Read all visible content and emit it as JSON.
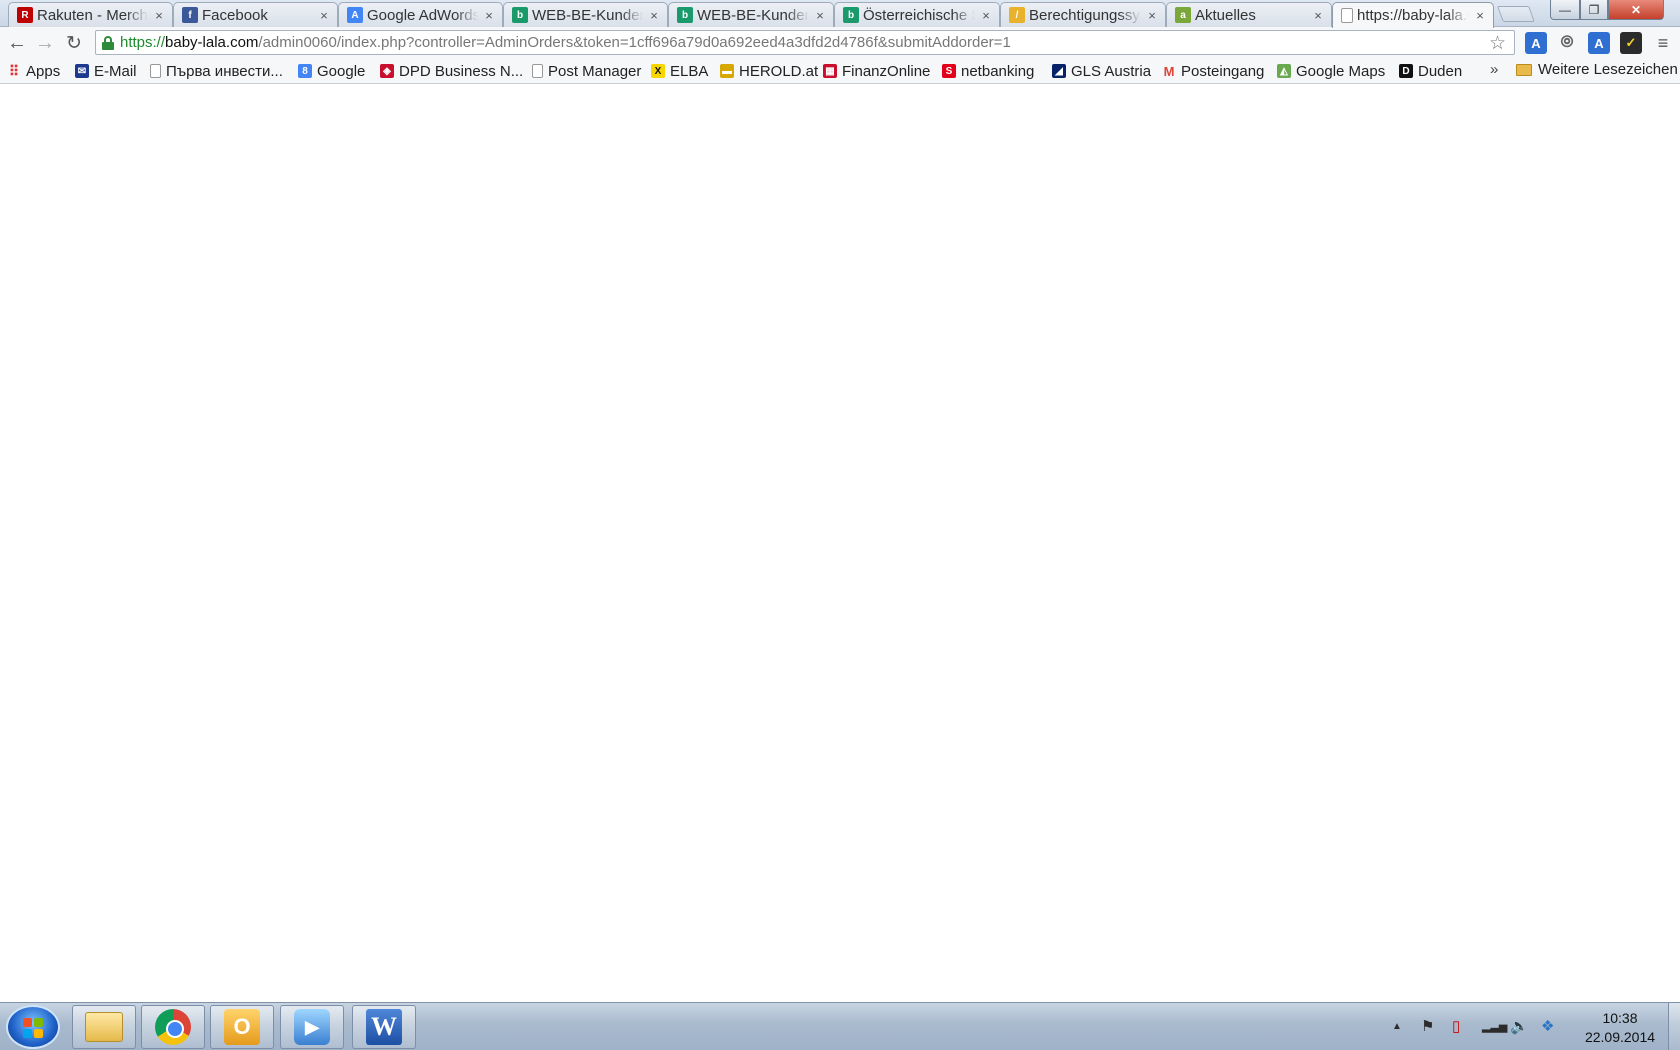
{
  "browser": {
    "tabs": [
      {
        "title": "Rakuten - Merchant",
        "favicon": "rakuten-icon",
        "icon_text": "R",
        "color": "#bf0000"
      },
      {
        "title": "Facebook",
        "favicon": "facebook-icon",
        "icon_text": "f",
        "color": "#3b5998"
      },
      {
        "title": "Google AdWords",
        "favicon": "adwords-icon",
        "icon_text": "A",
        "color": "#4285f4"
      },
      {
        "title": "WEB-BE-Kunden",
        "favicon": "web-be-icon",
        "icon_text": "b",
        "color": "#1a9a6b"
      },
      {
        "title": "WEB-BE-Kunden",
        "favicon": "web-be-icon",
        "icon_text": "b",
        "color": "#1a9a6b"
      },
      {
        "title": "Österreichische S",
        "favicon": "web-be-icon",
        "icon_text": "b",
        "color": "#1a9a6b"
      },
      {
        "title": "Berechtigungssystem",
        "favicon": "berechtigung-icon",
        "icon_text": "/",
        "color": "#e8b22d"
      },
      {
        "title": "Aktuelles",
        "favicon": "aktuelles-icon",
        "icon_text": "a",
        "color": "#7aa63a"
      },
      {
        "title": "https://baby-lala.com",
        "favicon": "page-icon",
        "icon_text": "",
        "color": "#ffffff",
        "active": true
      }
    ],
    "tab_close_glyph": "×",
    "window_buttons": {
      "minimize": "—",
      "maximize": "❐",
      "close": "✕"
    },
    "url": {
      "scheme": "https://",
      "host": "baby-lala.com",
      "path": "/admin0060/index.php?controller=AdminOrders&token=1cff696a79d0a692eed4a3dfd2d4786f&submitAddorder=1"
    },
    "nav": {
      "back": "←",
      "forward": "→",
      "reload": "↻",
      "star": "☆",
      "menu": "≡"
    },
    "extensions": {
      "translate": "A",
      "opera": "⦾",
      "check": "✓"
    },
    "bookmarks": [
      {
        "label": "Apps",
        "icon": "apps-grid-icon",
        "icon_text": "⠿",
        "color": "#d33"
      },
      {
        "label": "E-Mail",
        "icon": "email-icon",
        "icon_text": "✉",
        "color": "#1d3a8f"
      },
      {
        "label": "Първа инвести...",
        "icon": "page-icon",
        "icon_text": "",
        "color": "#ffffff"
      },
      {
        "label": "Google",
        "icon": "google-icon",
        "icon_text": "8",
        "color": "#4285f4"
      },
      {
        "label": "DPD Business N...",
        "icon": "dpd-icon",
        "icon_text": "◈",
        "color": "#c8102e"
      },
      {
        "label": "Post Manager",
        "icon": "page-icon",
        "icon_text": "",
        "color": "#ffffff"
      },
      {
        "label": "ELBA",
        "icon": "elba-icon",
        "icon_text": "X",
        "color": "#111111"
      },
      {
        "label": "HEROLD.at",
        "icon": "herold-icon",
        "icon_text": "▬",
        "color": "#d6a800"
      },
      {
        "label": "FinanzOnline",
        "icon": "finanzonline-icon",
        "icon_text": "▦",
        "color": "#c8102e"
      },
      {
        "label": "netbanking",
        "icon": "sparkasse-icon",
        "icon_text": "S",
        "color": "#e2001a"
      },
      {
        "label": "GLS Austria",
        "icon": "gls-icon",
        "icon_text": "◢",
        "color": "#06236a"
      },
      {
        "label": "Posteingang",
        "icon": "gmail-icon",
        "icon_text": "M",
        "color": "#db4437"
      },
      {
        "label": "Google Maps",
        "icon": "maps-icon",
        "icon_text": "◭",
        "color": "#6aa84f"
      },
      {
        "label": "Duden",
        "icon": "duden-icon",
        "icon_text": "D",
        "color": "#111111"
      }
    ],
    "bookmarks_more": "»",
    "other_bookmarks": "Weitere Lesezeichen"
  },
  "taskbar": {
    "apps": [
      {
        "name": "explorer",
        "label": ""
      },
      {
        "name": "chrome",
        "label": ""
      },
      {
        "name": "outlook",
        "label": "O"
      },
      {
        "name": "media",
        "label": "▶"
      },
      {
        "name": "word",
        "label": "W"
      }
    ],
    "tray": {
      "arrow": "▲",
      "flag": "⚑",
      "power": "▯",
      "network": "▂▃▅",
      "volume": "🔈",
      "dropbox": "❖"
    },
    "clock": {
      "time": "10:38",
      "date": "22.09.2014"
    }
  }
}
